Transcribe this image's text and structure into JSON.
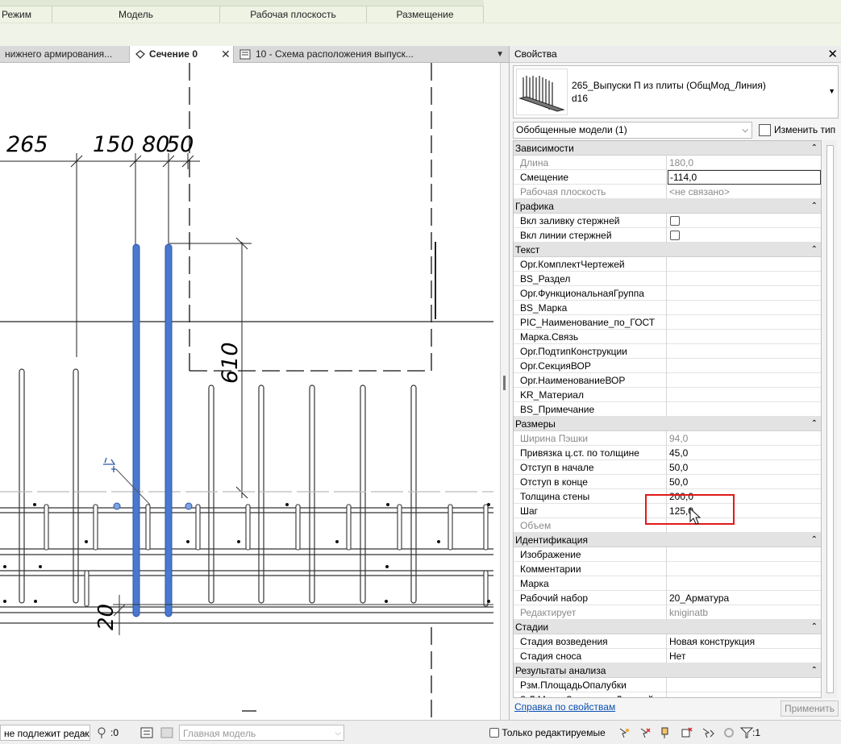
{
  "ribbon": {
    "panels": [
      "Режим",
      "Модель",
      "Рабочая плоскость",
      "Размещение"
    ]
  },
  "tabs": [
    {
      "label": "нижнего армирования...",
      "active": false
    },
    {
      "label": "Сечение 0",
      "active": true
    },
    {
      "label": "10 - Схема расположения выпуск...",
      "active": false
    }
  ],
  "drawing": {
    "dims": {
      "d265": "265",
      "d150": "150",
      "d80": "80",
      "d50": "50",
      "d610": "610",
      "d20": "20"
    }
  },
  "properties": {
    "title": "Свойства",
    "type_name_line1": "265_Выпуски П из плиты (ОбщМод_Линия)",
    "type_name_line2": "d16",
    "filter": "Обобщенные модели (1)",
    "edit_type": "Изменить тип",
    "groups": [
      {
        "title": "Зависимости",
        "rows": [
          {
            "name": "Длина",
            "value": "180,0",
            "ro": true
          },
          {
            "name": "Смещение",
            "value": "-114,0",
            "editing": true
          },
          {
            "name": "Рабочая плоскость",
            "value": "<не связано>",
            "ro": true
          }
        ]
      },
      {
        "title": "Графика",
        "rows": [
          {
            "name": "Вкл заливку стержней",
            "checkbox": true
          },
          {
            "name": "Вкл линии стержней",
            "checkbox": true
          }
        ]
      },
      {
        "title": "Текст",
        "rows": [
          {
            "name": "Орг.КомплектЧертежей",
            "value": ""
          },
          {
            "name": "BS_Раздел",
            "value": ""
          },
          {
            "name": "Орг.ФункциональнаяГруппа",
            "value": ""
          },
          {
            "name": "BS_Марка",
            "value": ""
          },
          {
            "name": "PIC_Наименование_по_ГОСТ",
            "value": ""
          },
          {
            "name": "Марка.Связь",
            "value": ""
          },
          {
            "name": "Орг.ПодтипКонструкции",
            "value": ""
          },
          {
            "name": "Орг.СекцияВОР",
            "value": ""
          },
          {
            "name": "Орг.НаименованиеВОР",
            "value": ""
          },
          {
            "name": "KR_Материал",
            "value": ""
          },
          {
            "name": "BS_Примечание",
            "value": ""
          }
        ]
      },
      {
        "title": "Размеры",
        "rows": [
          {
            "name": "Ширина Пэшки",
            "value": "94,0",
            "ro": true
          },
          {
            "name": "Привязка ц.ст. по толщине",
            "value": "45,0"
          },
          {
            "name": "Отступ в начале",
            "value": "50,0"
          },
          {
            "name": "Отступ в конце",
            "value": "50,0"
          },
          {
            "name": "Толщина стены",
            "value": "200,0"
          },
          {
            "name": "Шаг",
            "value": "125,0"
          },
          {
            "name": "Объем",
            "value": "",
            "ro": true
          }
        ]
      },
      {
        "title": "Идентификация",
        "rows": [
          {
            "name": "Изображение",
            "value": ""
          },
          {
            "name": "Комментарии",
            "value": ""
          },
          {
            "name": "Марка",
            "value": ""
          },
          {
            "name": "Рабочий набор",
            "value": "20_Арматура"
          },
          {
            "name": "Редактирует",
            "value": "kniginatb",
            "ro": true
          }
        ]
      },
      {
        "title": "Стадии",
        "rows": [
          {
            "name": "Стадия возведения",
            "value": "Новая конструкция"
          },
          {
            "name": "Стадия сноса",
            "value": "Нет"
          }
        ]
      },
      {
        "title": "Результаты анализа",
        "rows": [
          {
            "name": "Рзм.ПлощадьОпалубки",
            "value": ""
          },
          {
            "name": "З.Л.МассаЗакладныхДеталей",
            "value": ""
          }
        ]
      }
    ],
    "help_link": "Справка по свойствам",
    "apply": "Применить"
  },
  "statusbar": {
    "editable_dropdown": "не подлежит редак",
    "zero": ":0",
    "model": "Главная модель",
    "editable_only": "Только редактируемые",
    "filter_count": ":1"
  }
}
